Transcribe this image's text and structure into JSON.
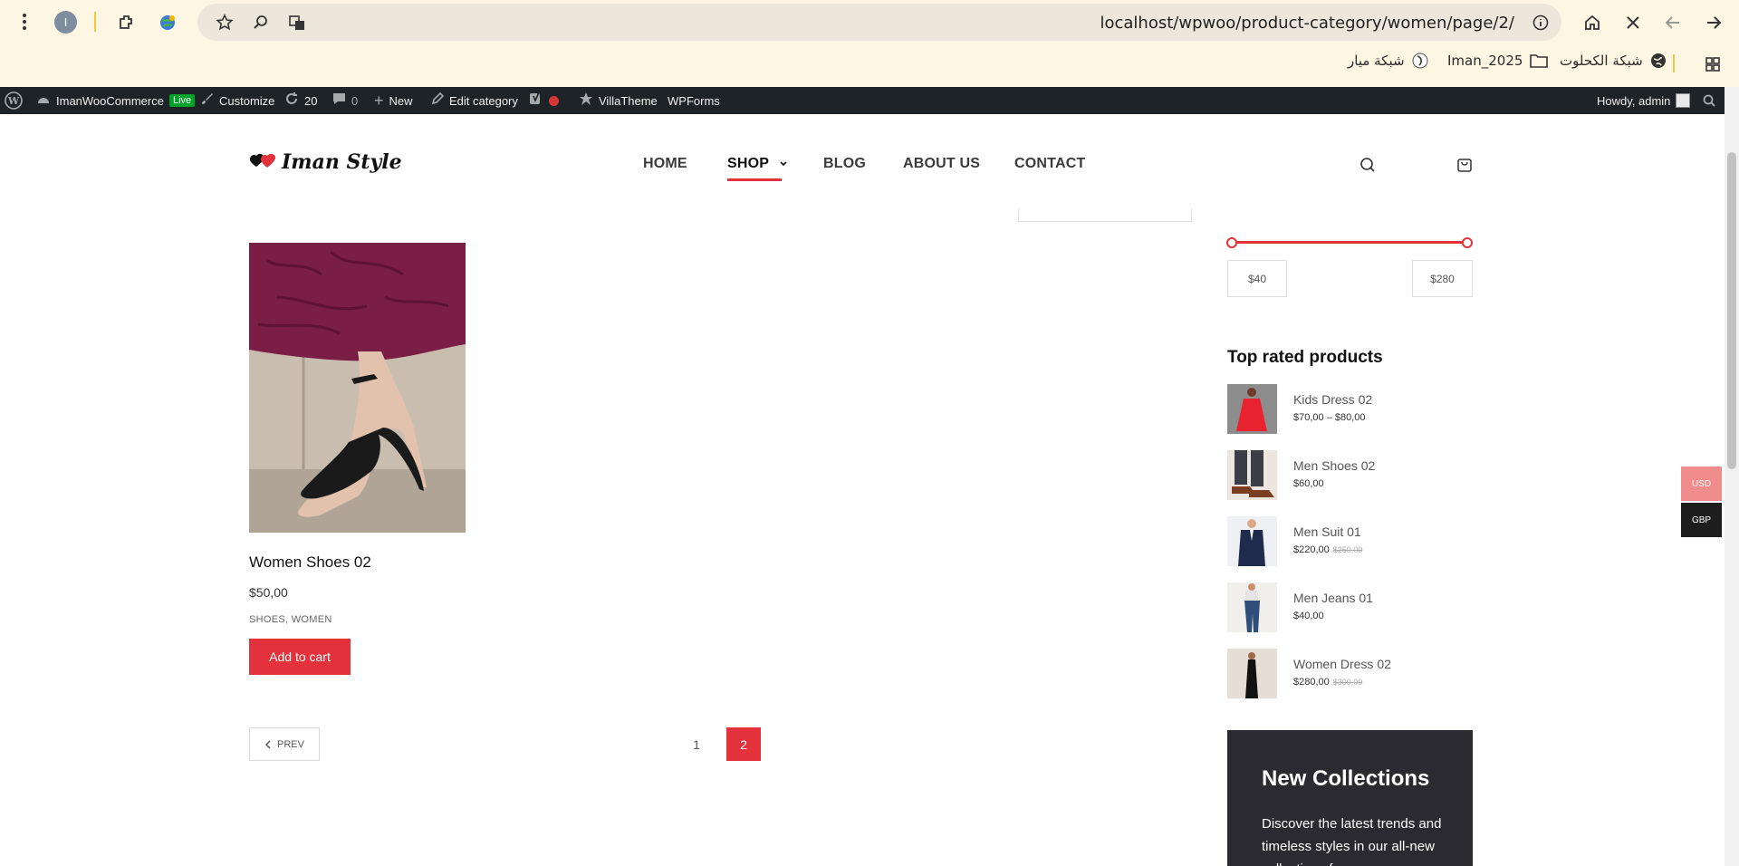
{
  "browser": {
    "profile_initial": "I",
    "url": "localhost/wpwoo/product-category/women/page/2/",
    "bookmarks": [
      "شبكة الكحلوت",
      "Iman_2025",
      "شبكة ميار"
    ]
  },
  "admin_bar": {
    "site_name": "ImanWooCommerce",
    "live_badge": "Live",
    "customize": "Customize",
    "updates_count": "20",
    "comments_count": "0",
    "new": "New",
    "edit_category": "Edit category",
    "villatheme": "VillaTheme",
    "wpforms": "WPForms",
    "howdy": "Howdy, admin"
  },
  "site": {
    "logo_text": "Iman Style",
    "nav": [
      {
        "label": "HOME"
      },
      {
        "label": "SHOP"
      },
      {
        "label": "BLOG"
      },
      {
        "label": "ABOUT US"
      },
      {
        "label": "CONTACT"
      }
    ],
    "active_nav": "SHOP"
  },
  "product": {
    "title": "Women Shoes 02",
    "price": "$50,00",
    "categories": "SHOES, WOMEN",
    "add_to_cart": "Add to cart"
  },
  "pagination": {
    "prev": "PREV",
    "pages": [
      "1",
      "2"
    ],
    "current": "2"
  },
  "sidebar": {
    "price_min": "$40",
    "price_max": "$280",
    "top_rated_title": "Top rated products",
    "top_rated": [
      {
        "name": "Kids Dress 02",
        "price": "$70,00 – $80,00",
        "old_price": ""
      },
      {
        "name": "Men Shoes 02",
        "price": "$60,00",
        "old_price": ""
      },
      {
        "name": "Men Suit 01",
        "price": "$220,00",
        "old_price": "$250,00"
      },
      {
        "name": "Men Jeans 01",
        "price": "$40,00",
        "old_price": ""
      },
      {
        "name": "Women Dress 02",
        "price": "$280,00",
        "old_price": "$300,00"
      }
    ],
    "promo_title": "New Collections",
    "promo_text": "Discover the latest trends and timeless styles in our all-new collections for"
  },
  "currency": {
    "usd": "USD",
    "gbp": "GBP"
  },
  "colors": {
    "accent": "#e3323b",
    "admin_bar": "#1d2327",
    "chrome": "#fdf6e3",
    "promo_bg": "#2b2a30"
  }
}
